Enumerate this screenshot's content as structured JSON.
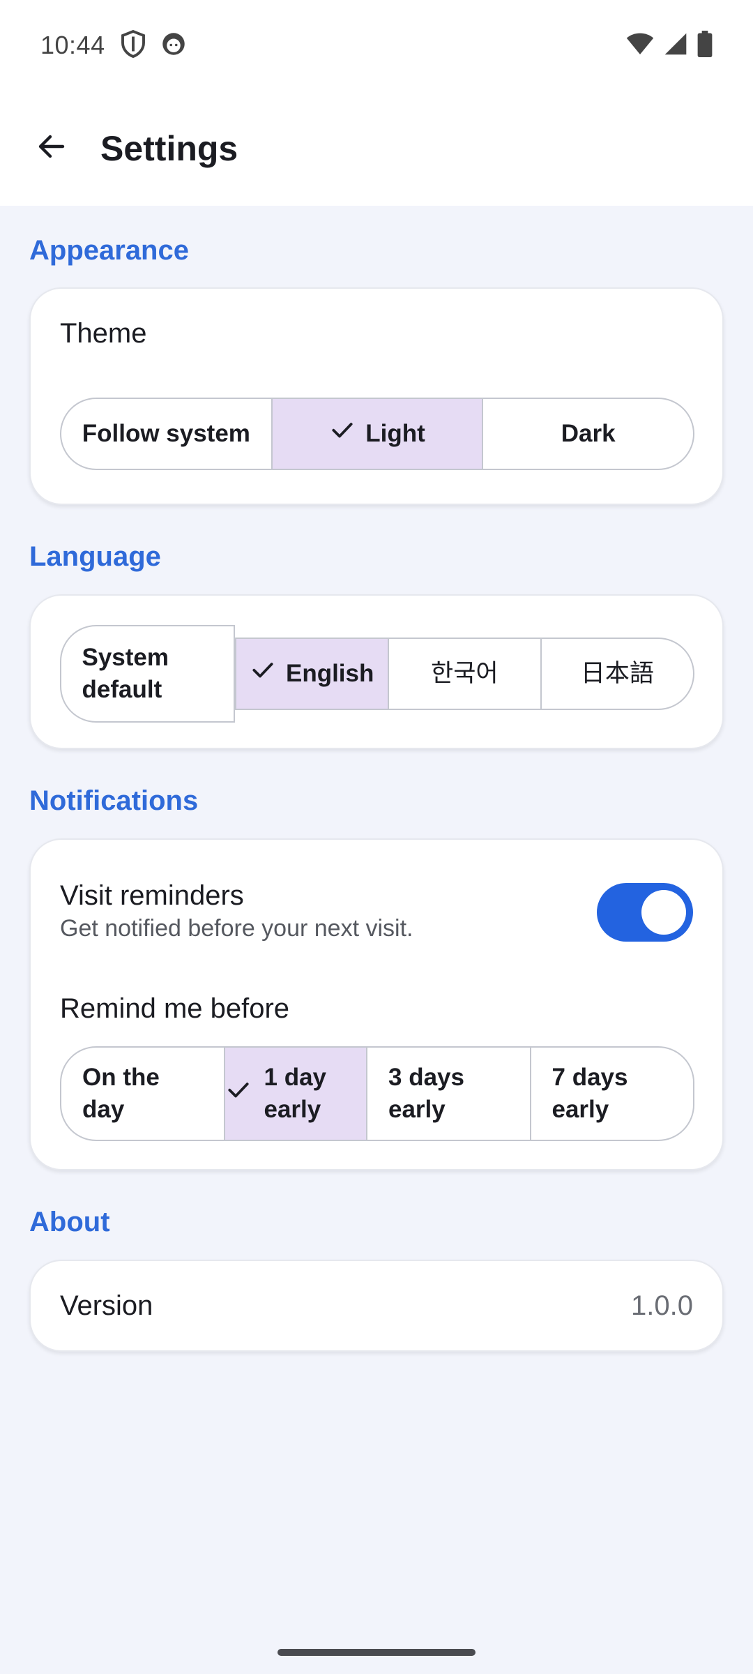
{
  "status": {
    "time": "10:44",
    "icons": [
      "shield-icon",
      "face-icon",
      "wifi-icon",
      "cellular-icon",
      "battery-icon"
    ]
  },
  "header": {
    "title": "Settings",
    "back_icon": "arrow-back-icon"
  },
  "colors": {
    "accent": "#2f6ad9",
    "selected_segment": "#e6dcf4",
    "toggle_on": "#2363e0",
    "background": "#f2f4fb"
  },
  "appearance": {
    "section": "Appearance",
    "theme_label": "Theme",
    "options": [
      "Follow system",
      "Light",
      "Dark"
    ],
    "selected": "Light"
  },
  "language": {
    "section": "Language",
    "options": [
      "System\ndefault",
      "English",
      "한국어",
      "日本語"
    ],
    "selected": "English"
  },
  "notifications": {
    "section": "Notifications",
    "visit_reminders": {
      "title": "Visit reminders",
      "subtitle": "Get notified before your next visit.",
      "enabled": true
    },
    "remind_label": "Remind me before",
    "options": [
      "On the\nday",
      "1 day\nearly",
      "3 days\nearly",
      "7 days\nearly"
    ],
    "selected": "1 day\nearly"
  },
  "about": {
    "section": "About",
    "version_label": "Version",
    "version_value": "1.0.0"
  }
}
